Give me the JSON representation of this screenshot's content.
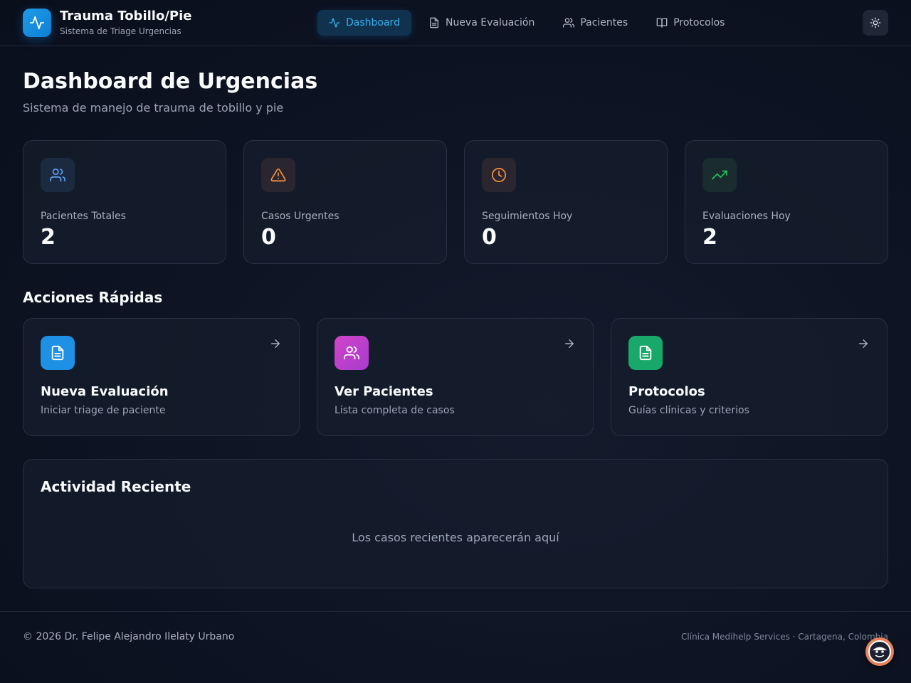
{
  "app": {
    "title": "Trauma Tobillo/Pie",
    "subtitle": "Sistema de Triage Urgencias",
    "logo_icon": "activity-icon"
  },
  "nav": [
    {
      "label": "Dashboard",
      "icon": "activity-icon",
      "active": true
    },
    {
      "label": "Nueva Evaluación",
      "icon": "file-text-icon",
      "active": false
    },
    {
      "label": "Pacientes",
      "icon": "users-icon",
      "active": false
    },
    {
      "label": "Protocolos",
      "icon": "book-open-icon",
      "active": false
    }
  ],
  "theme_toggle_icon": "sun-icon",
  "page": {
    "title": "Dashboard de Urgencias",
    "subtitle": "Sistema de manejo de trauma de tobillo y pie"
  },
  "stats": [
    {
      "label": "Pacientes Totales",
      "value": "2",
      "icon": "users-icon",
      "color": "#60a5fa"
    },
    {
      "label": "Casos Urgentes",
      "value": "0",
      "icon": "alert-triangle-icon",
      "color": "#fb923c"
    },
    {
      "label": "Seguimientos Hoy",
      "value": "0",
      "icon": "clock-icon",
      "color": "#fb923c"
    },
    {
      "label": "Evaluaciones Hoy",
      "value": "2",
      "icon": "trending-up-icon",
      "color": "#22c55e"
    }
  ],
  "quick_actions": {
    "title": "Acciones Rápidas",
    "items": [
      {
        "title": "Nueva Evaluación",
        "desc": "Iniciar triage de paciente",
        "icon": "file-text-icon",
        "color": "#1e90e6"
      },
      {
        "title": "Ver Pacientes",
        "desc": "Lista completa de casos",
        "icon": "users-icon",
        "color": "#c13fc9"
      },
      {
        "title": "Protocolos",
        "desc": "Guías clínicas y criterios",
        "icon": "file-text-icon",
        "color": "#17a86a"
      }
    ]
  },
  "recent": {
    "title": "Actividad Reciente",
    "empty": "Los casos recientes aparecerán aquí"
  },
  "footer": {
    "left": "© 2026 Dr. Felipe Alejandro Ilelaty Urbano",
    "right": "Clínica Medihelp Services · Cartagena, Colombia"
  }
}
